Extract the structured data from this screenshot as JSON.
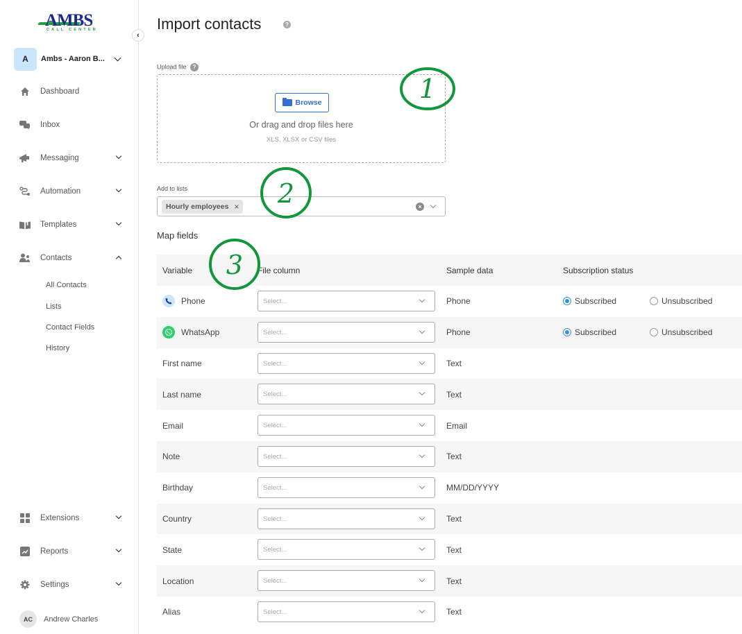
{
  "brand": {
    "logo_text": "AMBS",
    "logo_subtext": "CALL CENTER",
    "logo_color": "#1b2a8c",
    "accent_green": "#1fa142"
  },
  "account": {
    "initial": "A",
    "name": "Ambs - Aaron B..."
  },
  "sidebar": {
    "items": [
      {
        "label": "Dashboard",
        "icon": "home-icon",
        "expandable": false
      },
      {
        "label": "Inbox",
        "icon": "chat-bubbles-icon",
        "expandable": false
      },
      {
        "label": "Messaging",
        "icon": "megaphone-icon",
        "expandable": true
      },
      {
        "label": "Automation",
        "icon": "flow-icon",
        "expandable": true
      },
      {
        "label": "Templates",
        "icon": "book-icon",
        "expandable": true
      },
      {
        "label": "Contacts",
        "icon": "users-icon",
        "expandable": true,
        "expanded": true
      },
      {
        "label": "Extensions",
        "icon": "grid-icon",
        "expandable": true
      },
      {
        "label": "Reports",
        "icon": "chart-icon",
        "expandable": true
      },
      {
        "label": "Settings",
        "icon": "gear-icon",
        "expandable": true
      }
    ],
    "contacts_sub": [
      "All Contacts",
      "Lists",
      "Contact Fields",
      "History"
    ]
  },
  "user": {
    "initials": "AC",
    "name": "Andrew Charles"
  },
  "page": {
    "title": "Import contacts",
    "help_glyph": "?"
  },
  "upload": {
    "label": "Upload file",
    "browse_label": "Browse",
    "drop_text": "Or drag and drop files here",
    "formats": "XLS, XLSX or CSV files",
    "accent": "#2f6fd6"
  },
  "lists": {
    "label": "Add to lists",
    "selected": [
      "Hourly employees"
    ],
    "chip_remove": "×",
    "clear_glyph": "×"
  },
  "map_fields": {
    "title": "Map fields",
    "headers": {
      "variable": "Variable",
      "file_column": "File column",
      "sample_data": "Sample data",
      "subscription_status": "Subscription status"
    },
    "select_placeholder": "Select...",
    "radio_labels": {
      "subscribed": "Subscribed",
      "unsubscribed": "Unsubscribed"
    },
    "rows": [
      {
        "variable": "Phone",
        "icon": "phone-icon",
        "sample": "Phone",
        "status": "subscribed"
      },
      {
        "variable": "WhatsApp",
        "icon": "whatsapp-icon",
        "sample": "Phone",
        "status": "subscribed"
      },
      {
        "variable": "First name",
        "sample": "Text"
      },
      {
        "variable": "Last name",
        "sample": "Text"
      },
      {
        "variable": "Email",
        "sample": "Email"
      },
      {
        "variable": "Note",
        "sample": "Text"
      },
      {
        "variable": "Birthday",
        "sample": "MM/DD/YYYY"
      },
      {
        "variable": "Country",
        "sample": "Text"
      },
      {
        "variable": "State",
        "sample": "Text"
      },
      {
        "variable": "Location",
        "sample": "Text"
      },
      {
        "variable": "Alias",
        "sample": "Text"
      }
    ]
  },
  "annotations": {
    "color": "#12963a",
    "marks": [
      "1",
      "2",
      "3"
    ]
  }
}
